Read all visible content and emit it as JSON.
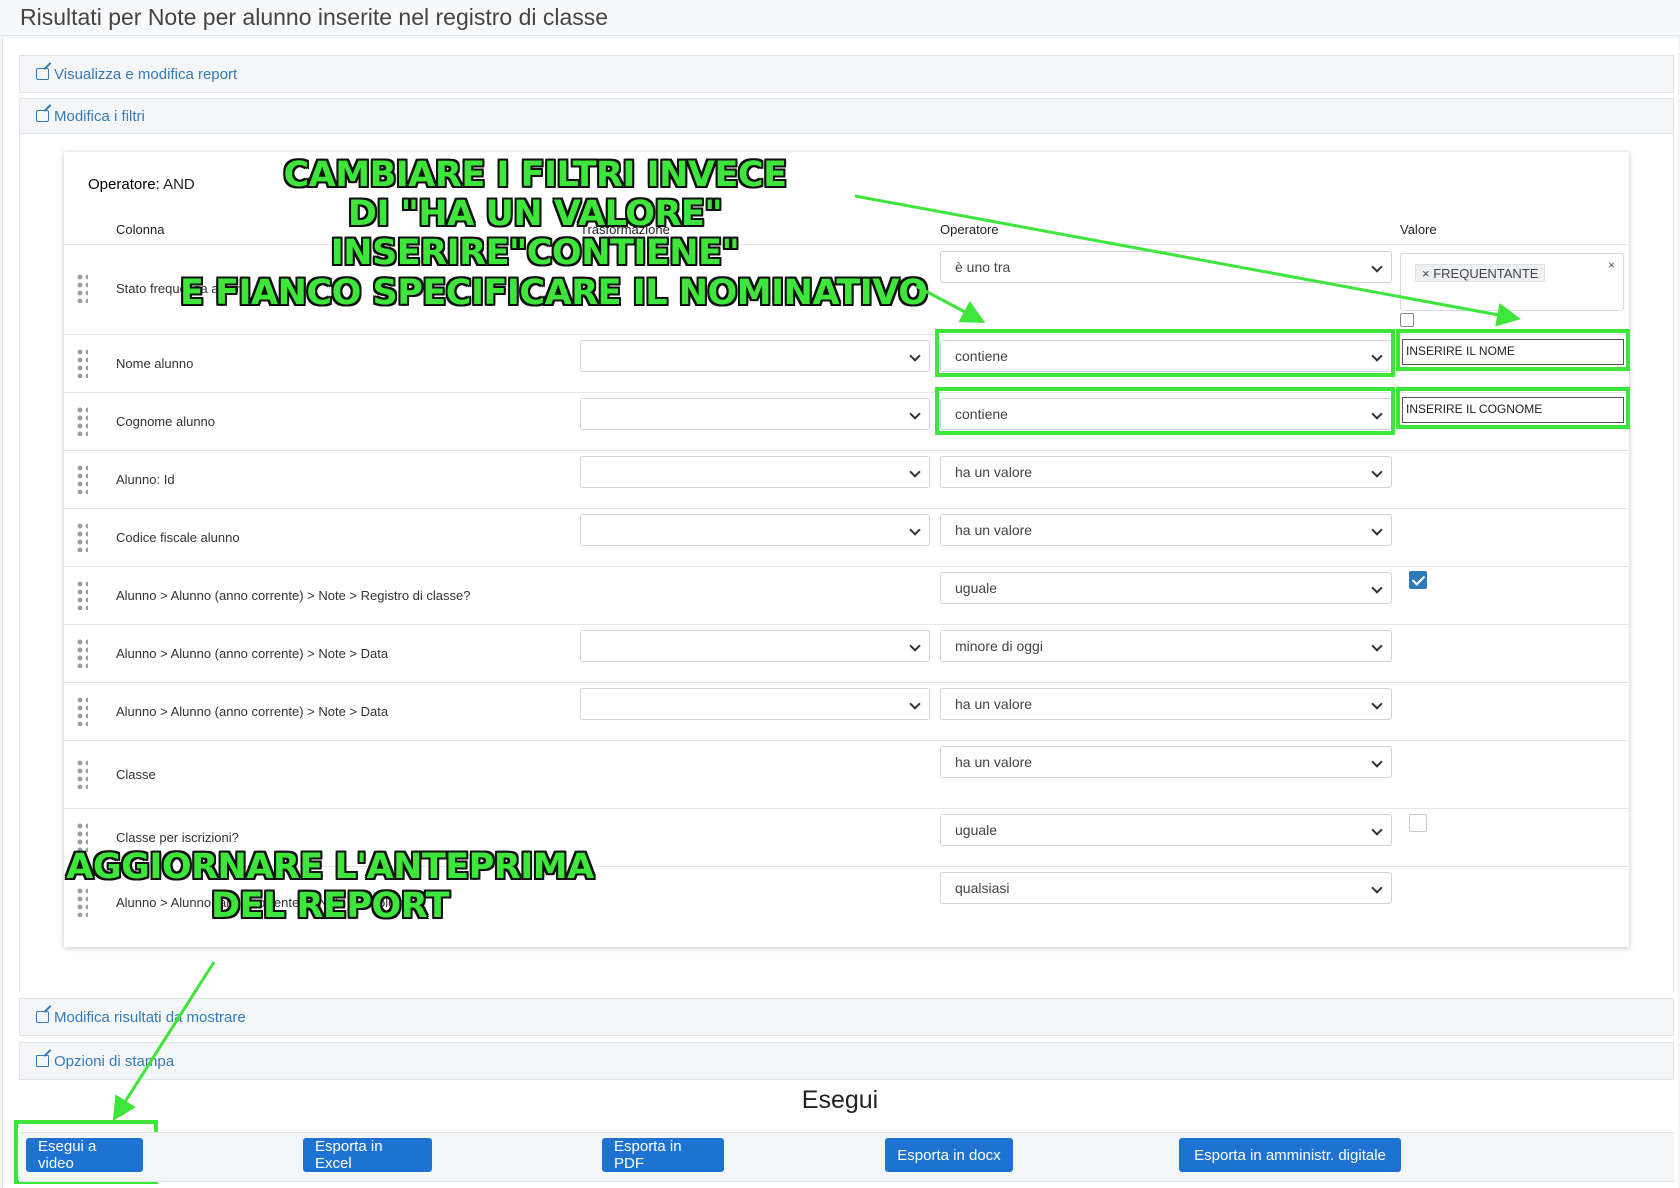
{
  "page": {
    "title": "Risultati per Note per alunno inserite nel registro di classe"
  },
  "panels": {
    "view_edit": "Visualizza e modifica report",
    "edit_filters": "Modifica i filtri",
    "edit_results": "Modifica risultati da mostrare",
    "print_options": "Opzioni di stampa"
  },
  "filters": {
    "operator_label": "Operatore:",
    "operator_value": "AND",
    "headers": {
      "column": "Colonna",
      "transform": "Trasformazione",
      "operator": "Operatore",
      "value": "Valore"
    },
    "rows": [
      {
        "column": "Stato frequenza alunno",
        "operator": "è uno tra",
        "value_tag": "FREQUENTANTE",
        "tag_remove": "×",
        "clear": "×"
      },
      {
        "column": "Nome alunno",
        "transform": "",
        "operator": "contiene",
        "value": "INSERIRE IL NOME"
      },
      {
        "column": "Cognome alunno",
        "transform": "",
        "operator": "contiene",
        "value": "INSERIRE IL COGNOME"
      },
      {
        "column": "Alunno: Id",
        "transform": "",
        "operator": "ha un valore"
      },
      {
        "column": "Codice fiscale alunno",
        "transform": "",
        "operator": "ha un valore"
      },
      {
        "column": "Alunno > Alunno (anno corrente) > Note > Registro di classe?",
        "operator": "uguale",
        "checked": true
      },
      {
        "column": "Alunno > Alunno (anno corrente) > Note > Data",
        "transform": "",
        "operator": "minore di oggi"
      },
      {
        "column": "Alunno > Alunno (anno corrente) > Note > Data",
        "transform": "",
        "operator": "ha un valore"
      },
      {
        "column": "Classe",
        "operator": "ha un valore"
      },
      {
        "column": "Classe per iscrizioni?",
        "operator": "uguale",
        "checked": false
      },
      {
        "column": "Alunno > Alunno (anno corrente) > Note > Tipologia",
        "operator": "qualsiasi"
      }
    ]
  },
  "annotations": {
    "top": [
      "CAMBIARE I FILTRI INVECE",
      "DI \"HA UN VALORE\"",
      "INSERIRE\"CONTIENE\"",
      "E FIANCO SPECIFICARE IL NOMINATIVO"
    ],
    "bottom": [
      "AGGIORNARE L'ANTEPRIMA",
      "DEL REPORT"
    ],
    "color": "#3ee53a"
  },
  "run": {
    "title": "Esegui",
    "buttons": [
      "Esegui a video",
      "Esporta in Excel",
      "Esporta in PDF",
      "Esporta in docx",
      "Esporta in amministr. digitale"
    ]
  },
  "colors": {
    "link": "#337ab7",
    "button": "#1e73d2",
    "checkbox": "#2f7ab8"
  }
}
